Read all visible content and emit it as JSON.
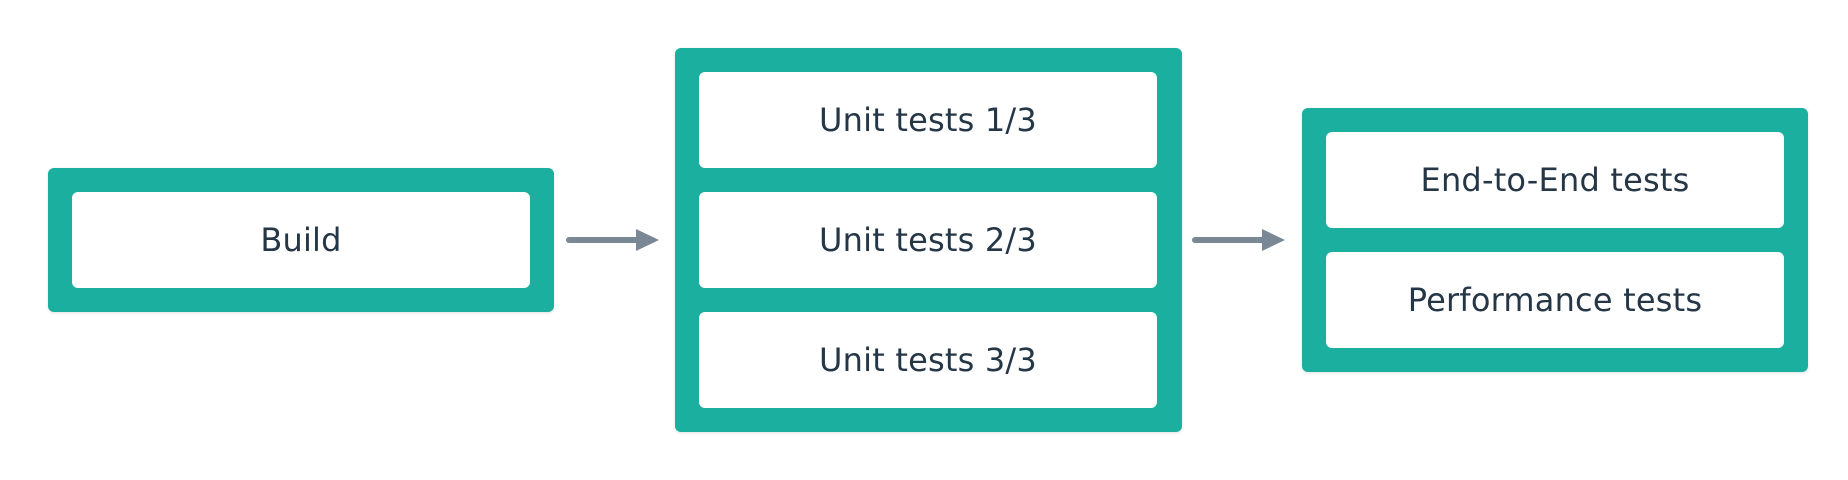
{
  "colors": {
    "stage_fill": "#1aaf9e",
    "job_fill": "#ffffff",
    "job_text": "#253646",
    "arrow": "#7a8895"
  },
  "stages": [
    {
      "jobs": [
        "Build"
      ]
    },
    {
      "jobs": [
        "Unit tests 1/3",
        "Unit tests 2/3",
        "Unit tests 3/3"
      ]
    },
    {
      "jobs": [
        "End-to-End tests",
        "Performance tests"
      ]
    }
  ]
}
